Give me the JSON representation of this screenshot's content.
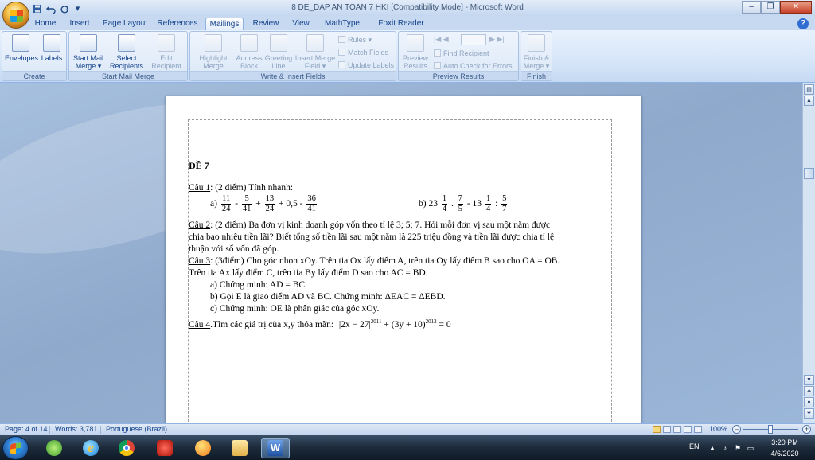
{
  "window": {
    "title": "8 DE_DAP AN TOAN 7 HKI [Compatibility Mode] - Microsoft Word",
    "minimize": "–",
    "maximize": "❐",
    "close": "✕"
  },
  "quick_access": {
    "customize": "▾"
  },
  "tabs": [
    "Home",
    "Insert",
    "Page Layout",
    "References",
    "Mailings",
    "Review",
    "View",
    "MathType",
    "Foxit Reader PDF"
  ],
  "active_tab": "Mailings",
  "ribbon": {
    "create": {
      "label": "Create",
      "envelopes": "Envelopes",
      "labels": "Labels"
    },
    "start_mail_merge": {
      "label": "Start Mail Merge",
      "start_l1": "Start Mail",
      "start_l2": "Merge ▾",
      "select_l1": "Select",
      "select_l2": "Recipients ▾",
      "edit_l1": "Edit",
      "edit_l2": "Recipient List"
    },
    "write_insert": {
      "label": "Write & Insert Fields",
      "highlight_l1": "Highlight",
      "highlight_l2": "Merge Fields",
      "address_l1": "Address",
      "address_l2": "Block",
      "greeting_l1": "Greeting",
      "greeting_l2": "Line",
      "insert_l1": "Insert Merge",
      "insert_l2": "Field ▾",
      "rules": "Rules ▾",
      "match_fields": "Match Fields",
      "update_labels": "Update Labels"
    },
    "preview": {
      "label": "Preview Results",
      "preview_l1": "Preview",
      "preview_l2": "Results",
      "find_recipient": "Find Recipient",
      "auto_check": "Auto Check for Errors",
      "first": "|◀",
      "prev": "◀",
      "next": "▶",
      "last": "▶|"
    },
    "finish": {
      "label": "Finish",
      "finish_l1": "Finish &",
      "finish_l2": "Merge ▾"
    }
  },
  "document": {
    "heading": "ĐỀ 7",
    "q1_label": "Câu 1",
    "q1_text": ": (2 điểm) Tính nhanh:",
    "q1a_prefix": "a)",
    "q1a_f1_num": "11",
    "q1a_f1_den": "24",
    "q1a_op1": "-",
    "q1a_f2_num": "5",
    "q1a_f2_den": "41",
    "q1a_op2": "+",
    "q1a_f3_num": "13",
    "q1a_f3_den": "24",
    "q1a_op3": "+ 0,5 -",
    "q1a_f4_num": "36",
    "q1a_f4_den": "41",
    "q1b_prefix": "b) 23",
    "q1b_f1_num": "1",
    "q1b_f1_den": "4",
    "q1b_op1": ".",
    "q1b_f2_num": "7",
    "q1b_f2_den": "5",
    "q1b_op2": "- 13",
    "q1b_f3_num": "1",
    "q1b_f3_den": "4",
    "q1b_op3": ":",
    "q1b_f4_num": "5",
    "q1b_f4_den": "7",
    "q2_label": "Câu 2",
    "q2_line1": ": (2 điểm) Ba đơn vị kinh doanh góp vốn theo tỉ lệ 3; 5; 7. Hỏi mỗi đơn vị sau một năm được",
    "q2_line2": "chia bao nhiêu tiền lãi? Biết tổng số tiền lãi sau một năm là 225 triệu đồng và tiền lãi được chia tỉ lệ",
    "q2_line3": "thuận với số vốn đã góp.",
    "q3_label": "Câu 3",
    "q3_line1": ": (3điểm) Cho góc nhọn xOy. Trên tia Ox lấy điểm A, trên tia Oy lấy điểm B sao cho OA = OB.",
    "q3_line2": "Trên tia Ax lấy điểm C, trên tia By lấy điểm D sao cho AC = BD.",
    "q3_a": "a) Chứng minh: AD = BC.",
    "q3_b": "b) Gọi E là giao điểm AD và BC. Chứng minh:  ΔEAC = ΔEBD.",
    "q3_c": "c) Chứng minh: OE là phân giác của góc xOy.",
    "q4_label": "Câu 4",
    "q4_text": ".Tìm  các giá trị của x,y thỏa mãn:",
    "q4_expr_a": "|2x − 27|",
    "q4_exp1": "2011",
    "q4_expr_b": "+ (3y + 10)",
    "q4_exp2": "2012",
    "q4_expr_c": "= 0"
  },
  "statusbar": {
    "page": "Page: 4 of 14",
    "words": "Words: 3,781",
    "language": "Portuguese (Brazil)",
    "zoom": "100%"
  },
  "taskbar": {
    "language": "EN",
    "time": "3:20 PM",
    "date": "4/6/2020"
  }
}
